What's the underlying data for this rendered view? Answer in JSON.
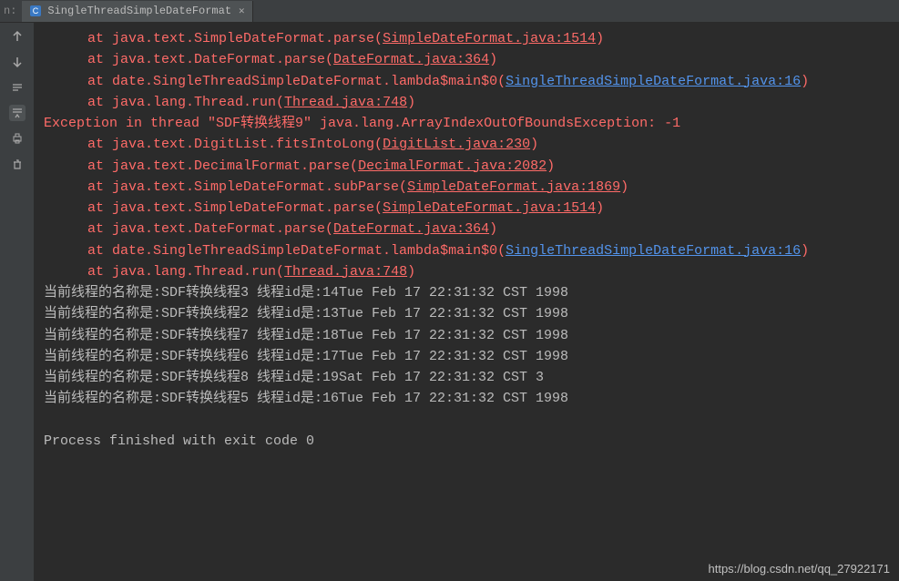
{
  "top": {
    "run_label": "n:",
    "tab_title": "SingleThreadSimpleDateFormat"
  },
  "stack1": [
    {
      "prefix": "at java.text.SimpleDateFormat.parse",
      "link": "SimpleDateFormat.java:1514",
      "blue": false
    },
    {
      "prefix": "at java.text.DateFormat.parse",
      "link": "DateFormat.java:364",
      "blue": false
    },
    {
      "prefix": "at date.SingleThreadSimpleDateFormat.lambda$main$0",
      "link": "SingleThreadSimpleDateFormat.java:16",
      "blue": true
    },
    {
      "prefix": "at java.lang.Thread.run",
      "link": "Thread.java:748",
      "blue": false
    }
  ],
  "exception_line": "Exception in thread \"SDF转换线程9\" java.lang.ArrayIndexOutOfBoundsException: -1",
  "stack2": [
    {
      "prefix": "at java.text.DigitList.fitsIntoLong",
      "link": "DigitList.java:230",
      "blue": false
    },
    {
      "prefix": "at java.text.DecimalFormat.parse",
      "link": "DecimalFormat.java:2082",
      "blue": false
    },
    {
      "prefix": "at java.text.SimpleDateFormat.subParse",
      "link": "SimpleDateFormat.java:1869",
      "blue": false
    },
    {
      "prefix": "at java.text.SimpleDateFormat.parse",
      "link": "SimpleDateFormat.java:1514",
      "blue": false
    },
    {
      "prefix": "at java.text.DateFormat.parse",
      "link": "DateFormat.java:364",
      "blue": false
    },
    {
      "prefix": "at date.SingleThreadSimpleDateFormat.lambda$main$0",
      "link": "SingleThreadSimpleDateFormat.java:16",
      "blue": true
    },
    {
      "prefix": "at java.lang.Thread.run",
      "link": "Thread.java:748",
      "blue": false
    }
  ],
  "stdout": [
    "当前线程的名称是:SDF转换线程3 线程id是:14Tue Feb 17 22:31:32 CST 1998",
    "当前线程的名称是:SDF转换线程2 线程id是:13Tue Feb 17 22:31:32 CST 1998",
    "当前线程的名称是:SDF转换线程7 线程id是:18Tue Feb 17 22:31:32 CST 1998",
    "当前线程的名称是:SDF转换线程6 线程id是:17Tue Feb 17 22:31:32 CST 1998",
    "当前线程的名称是:SDF转换线程8 线程id是:19Sat Feb 17 22:31:32 CST 3",
    "当前线程的名称是:SDF转换线程5 线程id是:16Tue Feb 17 22:31:32 CST 1998"
  ],
  "process_end": "Process finished with exit code 0",
  "watermark": "https://blog.csdn.net/qq_27922171"
}
